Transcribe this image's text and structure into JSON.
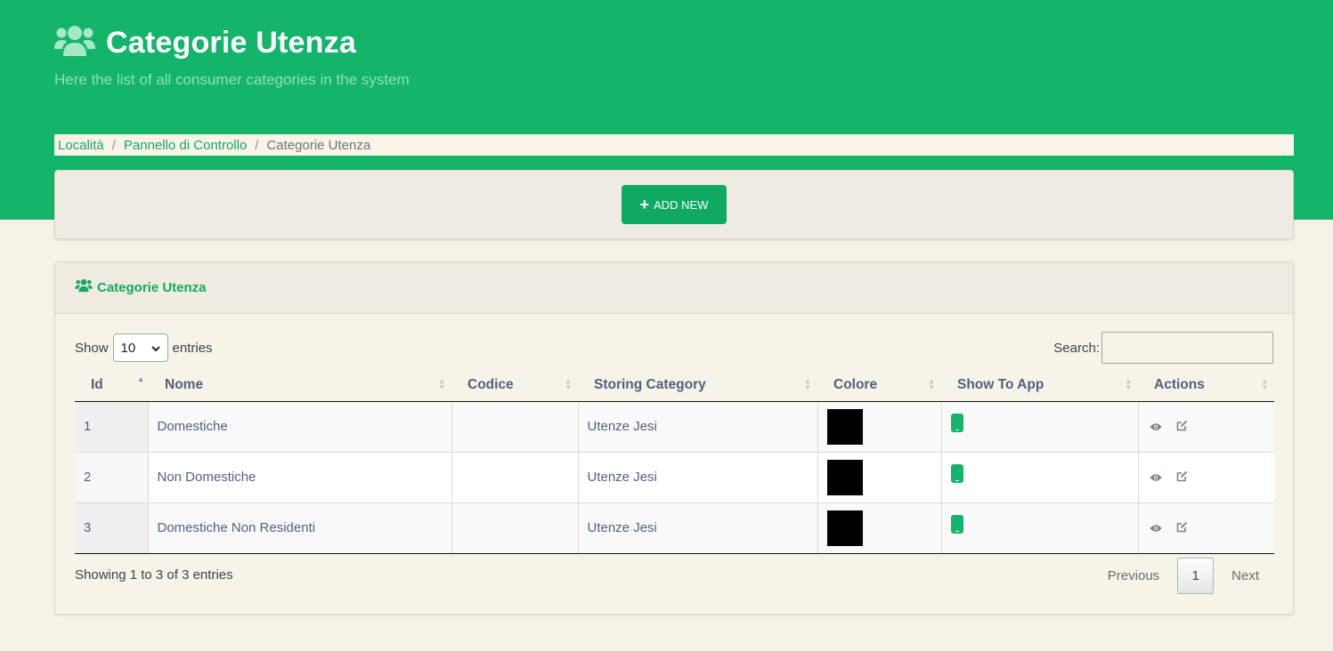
{
  "header": {
    "title": "Categorie Utenza",
    "subtitle": "Here the list of all consumer categories in the system"
  },
  "breadcrumb": {
    "items": [
      "Località",
      "Pannello di Controllo"
    ],
    "current": "Categorie Utenza"
  },
  "toolbar": {
    "add_label": "ADD NEW"
  },
  "card": {
    "title": "Categorie Utenza"
  },
  "table_controls": {
    "show_label": "Show",
    "page_length": "10",
    "entries_label": "entries",
    "search_label": "Search:",
    "search_value": ""
  },
  "table": {
    "columns": [
      "Id",
      "Nome",
      "Codice",
      "Storing Category",
      "Colore",
      "Show To App",
      "Actions"
    ],
    "rows": [
      {
        "id": "1",
        "nome": "Domestiche",
        "codice": "",
        "storing": "Utenze Jesi",
        "colore": "#000000",
        "show_to_app": true
      },
      {
        "id": "2",
        "nome": "Non Domestiche",
        "codice": "",
        "storing": "Utenze Jesi",
        "colore": "#000000",
        "show_to_app": true
      },
      {
        "id": "3",
        "nome": "Domestiche Non Residenti",
        "codice": "",
        "storing": "Utenze Jesi",
        "colore": "#000000",
        "show_to_app": true
      }
    ]
  },
  "footer": {
    "info": "Showing 1 to 3 of 3 entries",
    "previous": "Previous",
    "page": "1",
    "next": "Next"
  },
  "icons": {
    "header": "users-icon",
    "add": "plus-icon",
    "show_to_app": "mobile-icon",
    "view": "eye-icon",
    "edit": "edit-icon"
  },
  "colors": {
    "brand": "#14b56b",
    "button": "#0fa963",
    "background": "#f5f3e8"
  }
}
